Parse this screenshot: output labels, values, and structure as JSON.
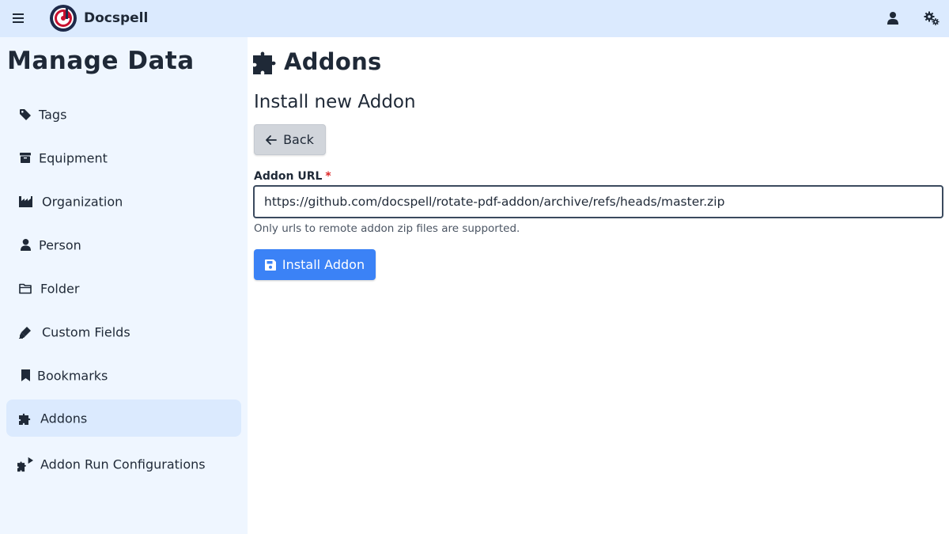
{
  "app": {
    "name": "Docspell"
  },
  "colors": {
    "topbar": "#dbeafe",
    "sidebar": "#eff6ff",
    "active_item": "#dbeafe",
    "primary": "#3b82f6",
    "required": "#dc2626"
  },
  "sidebar": {
    "title": "Manage Data",
    "items": [
      {
        "label": "Tags",
        "icon": "tag-icon",
        "active": false
      },
      {
        "label": "Equipment",
        "icon": "box-icon",
        "active": false
      },
      {
        "label": "Organization",
        "icon": "factory-icon",
        "active": false
      },
      {
        "label": "Person",
        "icon": "person-icon",
        "active": false
      },
      {
        "label": "Folder",
        "icon": "folder-icon",
        "active": false
      },
      {
        "label": "Custom Fields",
        "icon": "highlighter-icon",
        "active": false
      },
      {
        "label": "Bookmarks",
        "icon": "bookmark-icon",
        "active": false
      },
      {
        "label": "Addons",
        "icon": "puzzle-icon",
        "active": true
      },
      {
        "label": "Addon Run Configurations",
        "icon": "puzzle-play-icon",
        "active": false
      }
    ]
  },
  "main": {
    "title": "Addons",
    "subtitle": "Install new Addon",
    "back_label": "Back",
    "field_label": "Addon URL",
    "required_mark": "*",
    "url_value": "https://github.com/docspell/rotate-pdf-addon/archive/refs/heads/master.zip",
    "help_text": "Only urls to remote addon zip files are supported.",
    "install_label": "Install Addon"
  }
}
